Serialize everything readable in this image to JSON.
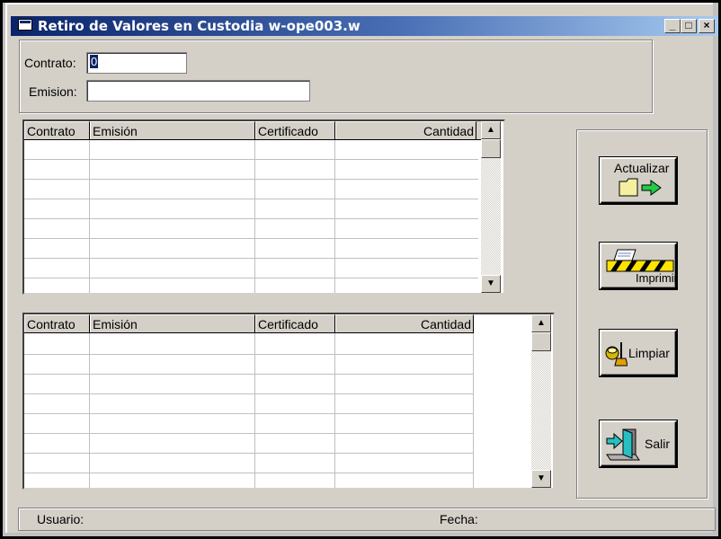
{
  "window": {
    "title": "Retiro de Valores en Custodia w-ope003.w",
    "controls": [
      "_",
      "□",
      "×"
    ]
  },
  "form": {
    "contrato_label": "Contrato:",
    "contrato_value": "0",
    "emision_label": "Emision:",
    "emision_value": ""
  },
  "grid_top": {
    "columns": [
      "Contrato",
      "Emisión",
      "Certificado",
      "Cantidad"
    ],
    "rows": 8
  },
  "grid_bottom": {
    "columns": [
      "Contrato",
      "Emisión",
      "Certificado",
      "Cantidad"
    ],
    "rows": 8
  },
  "buttons": {
    "actualizar": "Actualizar",
    "imprimir": "Imprimir",
    "limpiar": "Limpiar",
    "salir": "Salir"
  },
  "status": {
    "usuario_label": "Usuario:",
    "fecha_label": "Fecha:"
  },
  "colors": {
    "titlebar": "#0a246a",
    "face": "#d4d0c8"
  },
  "icons": {
    "actualizar": "folder-arrow-icon",
    "imprimir": "printer-icon",
    "limpiar": "broom-bucket-icon",
    "salir": "exit-door-icon"
  }
}
